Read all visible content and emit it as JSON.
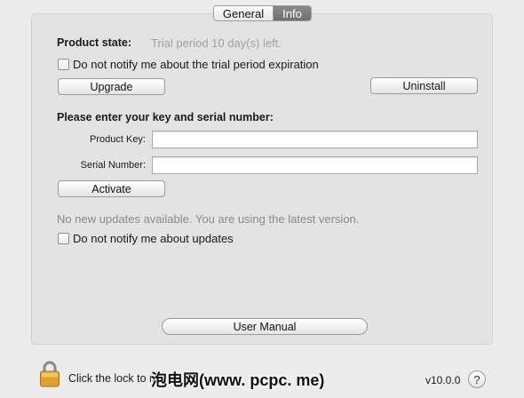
{
  "tabs": [
    {
      "label": "General",
      "selected": false
    },
    {
      "label": "Info",
      "selected": true
    }
  ],
  "product_state": {
    "label": "Product state:",
    "value": "Trial period 10 day(s) left."
  },
  "trial_notify": {
    "label": "Do not notify me about the trial period expiration",
    "checked": false
  },
  "buttons": {
    "upgrade": "Upgrade",
    "uninstall": "Uninstall",
    "activate": "Activate",
    "user_manual": "User Manual"
  },
  "key_section": {
    "heading": "Please enter your key and serial number:",
    "product_key_label": "Product Key:",
    "product_key_value": "",
    "serial_label": "Serial Number:",
    "serial_value": ""
  },
  "updates": {
    "status": "No new updates available. You are using the latest version.",
    "notify_label": "Do not notify me about updates",
    "notify_checked": false
  },
  "footer": {
    "lock_text": "Click the lock to m",
    "version": "v10.0.0",
    "help": "?",
    "watermark": "泡电网(www. pcpc. me)"
  },
  "colors": {
    "selected_tab": "#7d7d7d",
    "panel": "#e3e3e3",
    "lock": "#e0a22b"
  },
  "icons": [
    "lock-icon",
    "help-icon",
    "checkbox-icon"
  ]
}
